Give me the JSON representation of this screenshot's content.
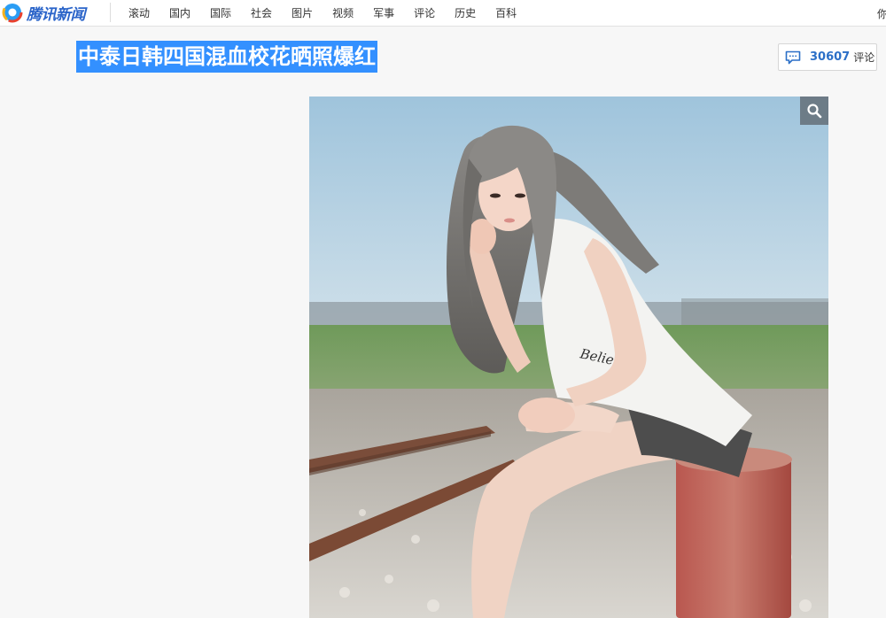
{
  "header": {
    "logo_text": "腾讯新闻",
    "nav": [
      "滚动",
      "国内",
      "国际",
      "社会",
      "图片",
      "视频",
      "军事",
      "评论",
      "历史",
      "百科"
    ],
    "right_text": "你"
  },
  "article": {
    "title": "中泰日韩四国混血校花晒照爆红",
    "comment_count": "30607",
    "comment_label": "评论",
    "shirt_text": "Belie"
  },
  "colors": {
    "title_highlight": "#3390ff",
    "comment_count": "#2b6fc7",
    "brand": "#2a64c9"
  },
  "icons": {
    "comment": "comment-bubble-icon",
    "zoom": "search-icon",
    "logo": "tencent-news-logo"
  }
}
